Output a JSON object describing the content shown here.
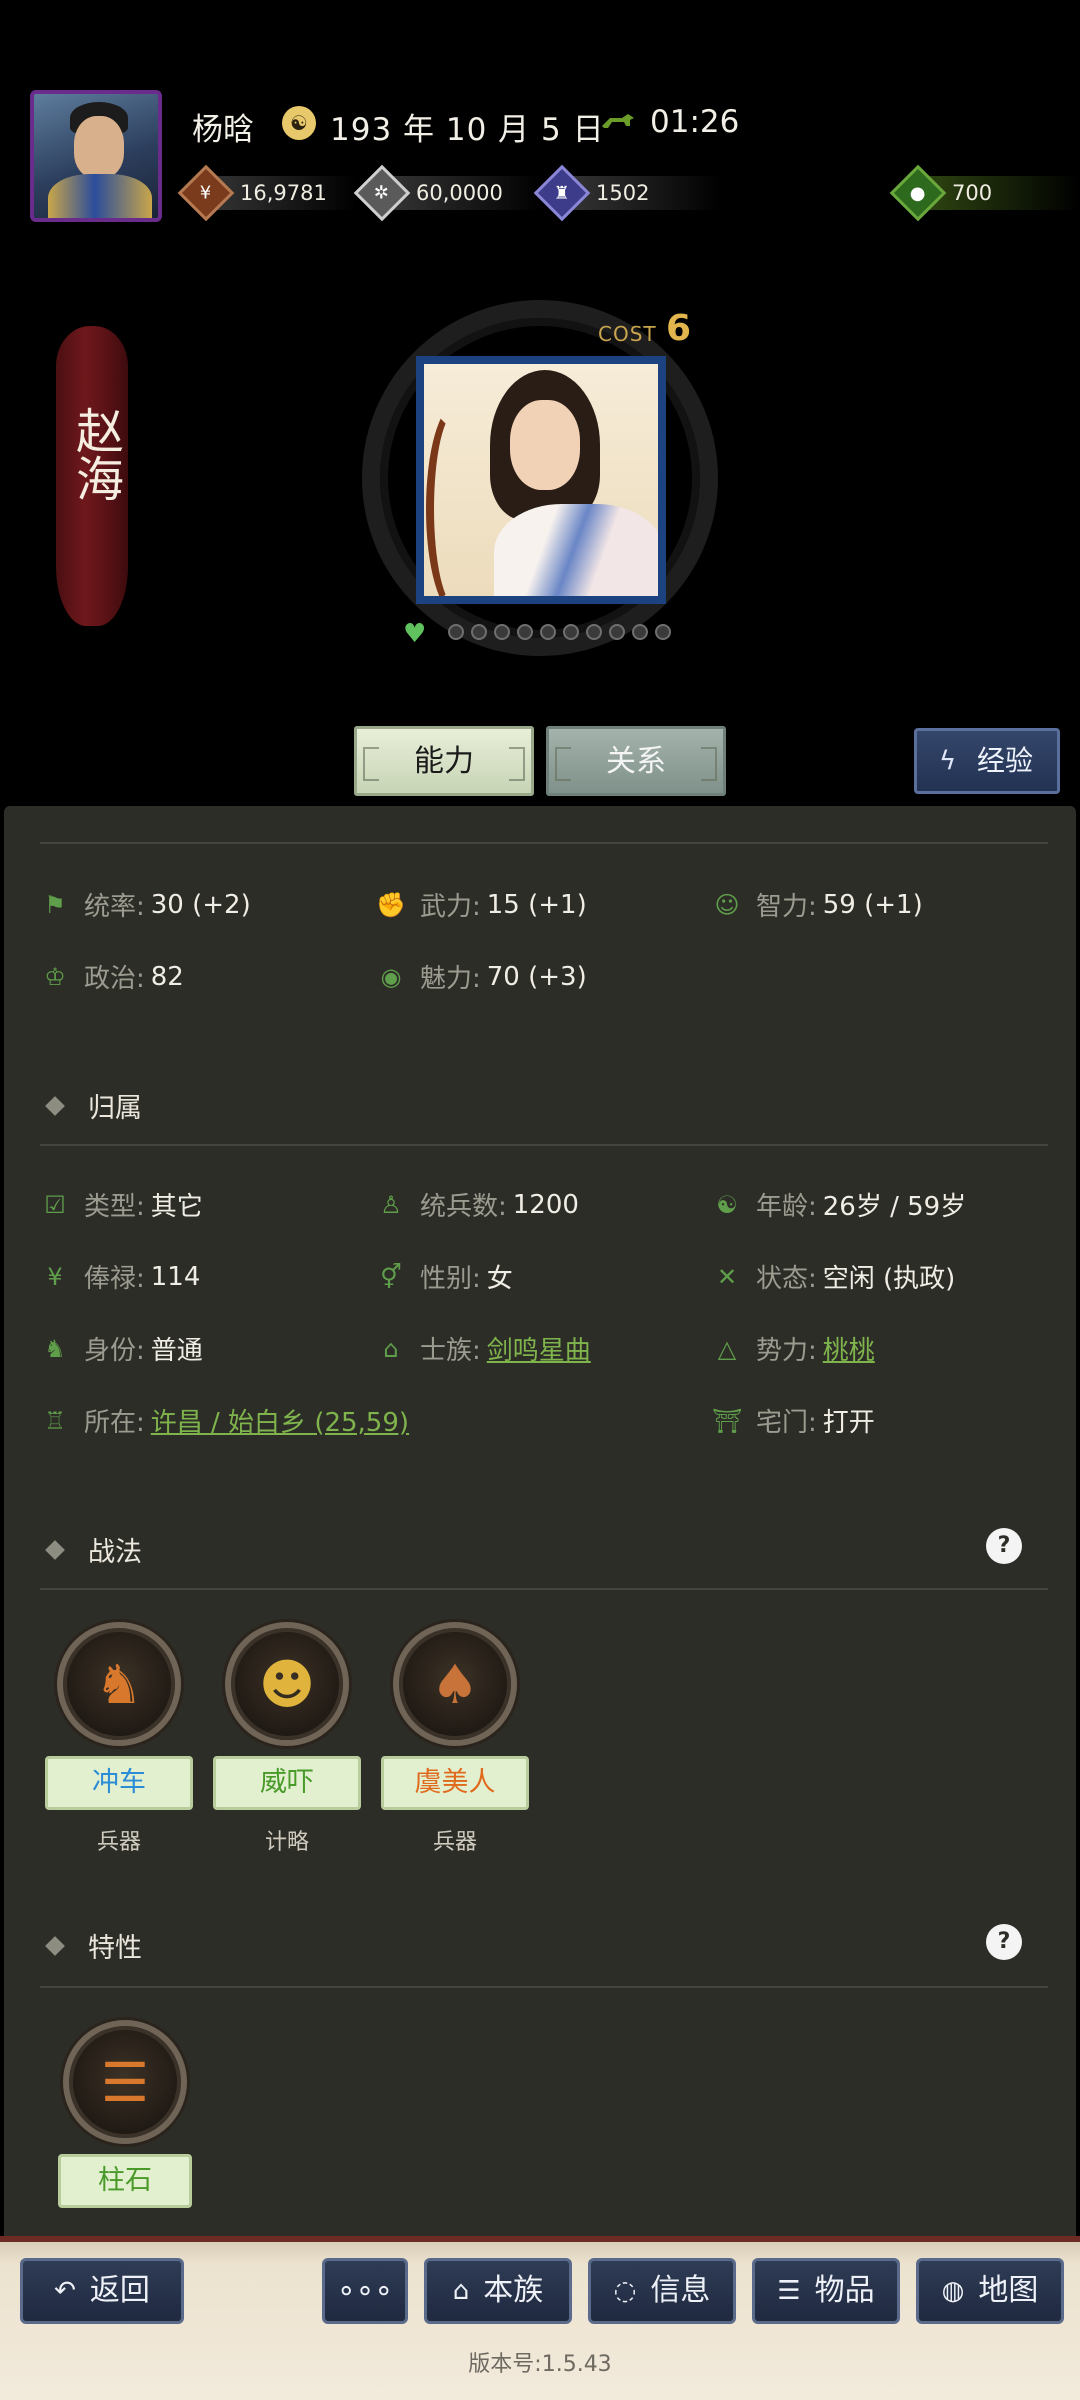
{
  "header": {
    "player_name": "杨晗",
    "date_icon": "calendar-icon",
    "date": "193 年 10 月 5 日",
    "clock_icon": "horse-clock-icon",
    "time": "01:26",
    "resources": {
      "money": "16,9781",
      "food": "60,0000",
      "troops": "1502",
      "gold": "700"
    }
  },
  "hero": {
    "name": "赵海",
    "cost_label": "COST",
    "cost_value": "6",
    "loyalty_dots": 10
  },
  "tabs": {
    "ability": "能力",
    "relation": "关系",
    "experience": "经验"
  },
  "stats": {
    "command": {
      "label": "统率:",
      "value": "30 (+2)"
    },
    "force": {
      "label": "武力:",
      "value": "15 (+1)"
    },
    "intellect": {
      "label": "智力:",
      "value": "59 (+1)"
    },
    "politics": {
      "label": "政治:",
      "value": "82"
    },
    "charm": {
      "label": "魅力:",
      "value": "70 (+3)"
    }
  },
  "affiliation": {
    "title": "归属",
    "type": {
      "label": "类型:",
      "value": "其它"
    },
    "troop_count": {
      "label": "统兵数:",
      "value": "1200"
    },
    "age": {
      "label": "年龄:",
      "value": "26岁 / 59岁"
    },
    "salary": {
      "label": "俸禄:",
      "value": "114"
    },
    "gender": {
      "label": "性别:",
      "value": "女"
    },
    "status": {
      "label": "状态:",
      "value": "空闲 (执政)"
    },
    "identity": {
      "label": "身份:",
      "value": "普通"
    },
    "clan": {
      "label": "士族:",
      "value": "剑鸣星曲"
    },
    "faction": {
      "label": "势力:",
      "value": "桃桃"
    },
    "location": {
      "label": "所在:",
      "value": "许昌 / 始白乡 (25,59)"
    },
    "gate": {
      "label": "宅门:",
      "value": "打开"
    }
  },
  "tactics": {
    "title": "战法",
    "items": [
      {
        "name": "冲车",
        "type": "兵器",
        "icon": "siege-horse-icon",
        "color": "#2d8cd6"
      },
      {
        "name": "威吓",
        "type": "计略",
        "icon": "roar-mask-icon",
        "color": "#4a9a2a"
      },
      {
        "name": "虞美人",
        "type": "兵器",
        "icon": "fox-icon",
        "color": "#e06a1c"
      }
    ]
  },
  "traits": {
    "title": "特性",
    "items": [
      {
        "name": "柱石",
        "icon": "pillar-icon",
        "color": "#4a9a2a"
      }
    ]
  },
  "bottom_bar": {
    "back": "返回",
    "more": "∘∘∘",
    "clan": "本族",
    "info": "信息",
    "items": "物品",
    "map": "地图",
    "version": "版本号:1.5.43"
  }
}
